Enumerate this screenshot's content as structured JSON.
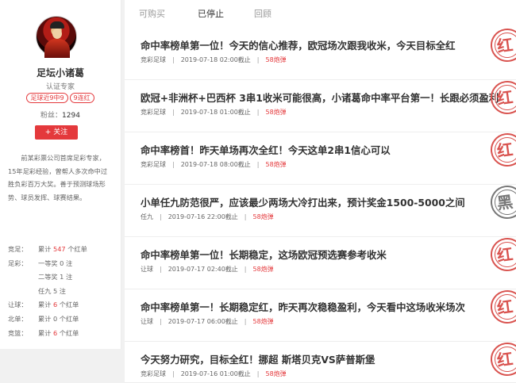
{
  "expert": {
    "name": "足坛小诸葛",
    "cert": "认证专家",
    "tags": [
      "足球近9中9",
      "9连红"
    ],
    "fans_label": "粉丝：",
    "fans_count": "1294",
    "follow_label": "+ 关注",
    "bio": "前某彩票公司首席足彩专家，15年足彩经验，曾帮人多次命中过胜负彩百万大奖。善于预测球场形势、球员发挥、球赛结果。"
  },
  "stats": [
    {
      "label": "竞足：",
      "pre": "累计 ",
      "num": "547",
      "post": " 个红单",
      "hl": true
    },
    {
      "label": "足彩：",
      "pre": "一等奖 ",
      "num": "0",
      "post": " 注",
      "hl": false
    },
    {
      "label": "",
      "pre": "二等奖 ",
      "num": "1",
      "post": " 注",
      "hl": false
    },
    {
      "label": "",
      "pre": "任九 ",
      "num": "5",
      "post": " 注",
      "hl": false
    },
    {
      "label": "让球：",
      "pre": "累计 ",
      "num": "6",
      "post": " 个红单",
      "hl": true
    },
    {
      "label": "北单：",
      "pre": "累计 ",
      "num": "0",
      "post": " 个红单",
      "hl": false
    },
    {
      "label": "竞篮：",
      "pre": "累计 ",
      "num": "6",
      "post": " 个红单",
      "hl": true
    }
  ],
  "tabs": [
    {
      "label": "可购买",
      "active": false
    },
    {
      "label": "已停止",
      "active": true
    },
    {
      "label": "回顾",
      "active": false
    }
  ],
  "items": [
    {
      "title": "命中率榜单第一位！今天的信心推荐，欧冠场次跟我收米，今天目标全红",
      "cat": "竞彩足球",
      "time": "2019-07-18 02:00截止",
      "price": "58symbol",
      "stamp": "红",
      "stamp_color": "red"
    },
    {
      "title": "欧冠+非洲杯+巴西杯 3串1收米可能很高，小诸葛命中率平台第一！长跟必须盈利",
      "cat": "竞彩足球",
      "time": "2019-07-18 01:00截止",
      "price": "58symbol",
      "stamp": "红",
      "stamp_color": "red"
    },
    {
      "title": "命中率榜首！昨天单场再次全红！今天这单2串1信心可以",
      "cat": "竞彩足球",
      "time": "2019-07-18 08:00截止",
      "price": "58symbol",
      "stamp": "红",
      "stamp_color": "red"
    },
    {
      "title": "小单任九防范很严，应该最少两场大冷打出来，预计奖金1500-5000之间",
      "cat": "任九",
      "time": "2019-07-16 22:00截止",
      "price": "58symbol",
      "stamp": "黑",
      "stamp_color": "black"
    },
    {
      "title": "命中率榜单第一位！长期稳定，这场欧冠预选赛参考收米",
      "cat": "让球",
      "time": "2019-07-17 02:40截止",
      "price": "58symbol",
      "stamp": "红",
      "stamp_color": "red"
    },
    {
      "title": "命中率榜单第一！长期稳定红，昨天再次稳稳盈利，今天看中这场收米场次",
      "cat": "让球",
      "time": "2019-07-17 06:00截止",
      "price": "58symbol",
      "stamp": "红",
      "stamp_color": "red"
    },
    {
      "title": "今天努力研究，目标全红！挪超 斯塔贝克VS萨普斯堡",
      "cat": "竞彩足球",
      "time": "2019-07-16 01:00截止",
      "price": "58symbol",
      "stamp": "红",
      "stamp_color": "red"
    }
  ],
  "colors": {
    "accent": "#e4393c",
    "stamp_red": "#d9534f",
    "stamp_black": "#777777"
  }
}
